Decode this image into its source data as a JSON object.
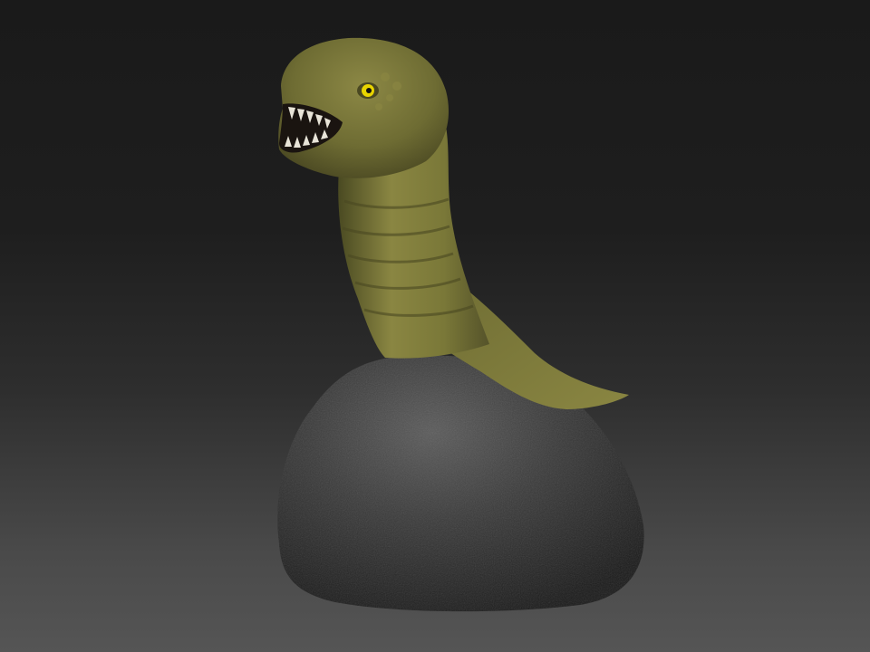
{
  "scene": {
    "subject": "creature-sculpt",
    "colors": {
      "background_top": "#1a1a1a",
      "background_bottom": "#555555",
      "skin": "#7a7838",
      "skin_shadow": "#4a4a22",
      "eye": "#e8d400",
      "rock": "#3a3a3a",
      "rock_shadow": "#1c1c1c"
    }
  }
}
